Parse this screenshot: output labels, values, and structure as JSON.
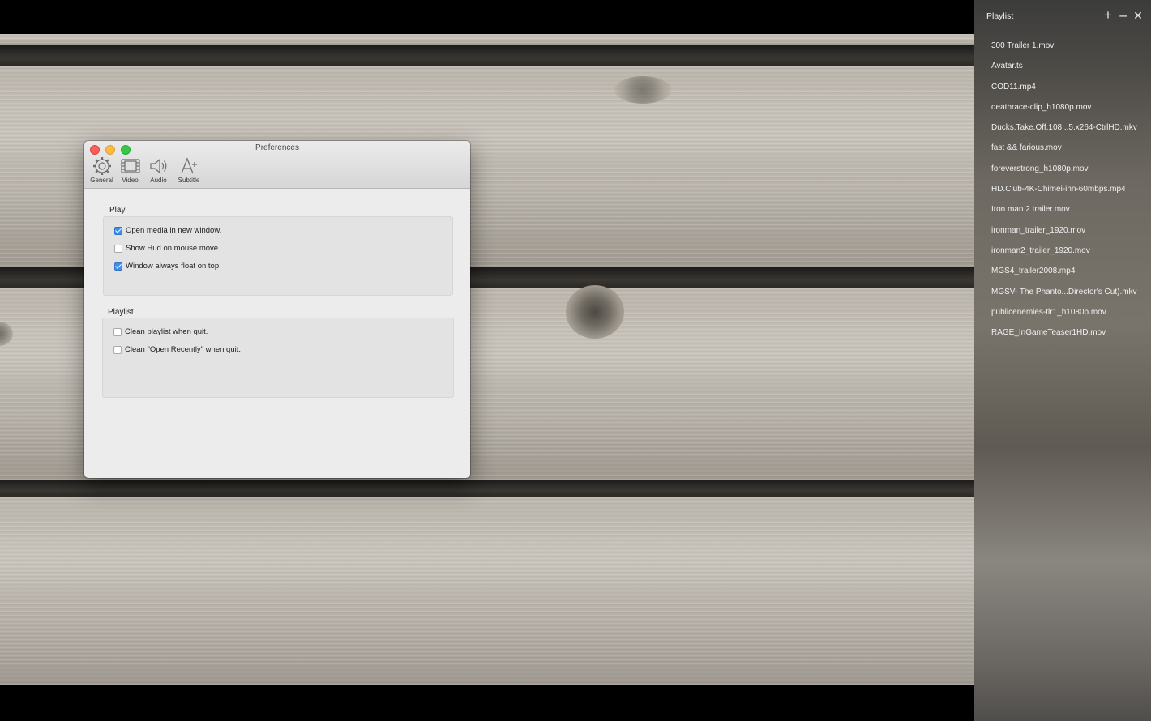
{
  "preferences": {
    "title": "Preferences",
    "toolbar": [
      {
        "label": "General",
        "icon": "gear-icon"
      },
      {
        "label": "Video",
        "icon": "film-icon"
      },
      {
        "label": "Audio",
        "icon": "speaker-icon"
      },
      {
        "label": "Subtitle",
        "icon": "subtitle-icon"
      }
    ],
    "play": {
      "heading": "Play",
      "options": [
        {
          "label": "Open media in new window.",
          "checked": true
        },
        {
          "label": "Show Hud on mouse move.",
          "checked": false
        },
        {
          "label": "Window always float on top.",
          "checked": true
        }
      ]
    },
    "playlist": {
      "heading": "Playlist",
      "options": [
        {
          "label": "Clean playlist when quit.",
          "checked": false
        },
        {
          "label": "Clean \"Open Recently\" when quit.",
          "checked": false
        }
      ]
    }
  },
  "playlist_panel": {
    "title": "Playlist",
    "controls": {
      "add": "+",
      "minimize": "–",
      "close": "✕"
    },
    "items": [
      "300 Trailer 1.mov",
      "Avatar.ts",
      "COD11.mp4",
      "deathrace-clip_h1080p.mov",
      "Ducks.Take.Off.108...5.x264-CtrlHD.mkv",
      "fast && farious.mov",
      "foreverstrong_h1080p.mov",
      "HD.Club-4K-Chimei-inn-60mbps.mp4",
      "Iron man 2 trailer.mov",
      "ironman_trailer_1920.mov",
      "ironman2_trailer_1920.mov",
      "MGS4_trailer2008.mp4",
      "MGSV- The Phanto...Director's Cut).mkv",
      "publicenemies-tlr1_h1080p.mov",
      "RAGE_InGameTeaser1HD.mov"
    ]
  },
  "colors": {
    "accent": "#3f8ee8",
    "close": "#fc605b",
    "minimize": "#fdbc40",
    "zoom": "#34c84a"
  }
}
